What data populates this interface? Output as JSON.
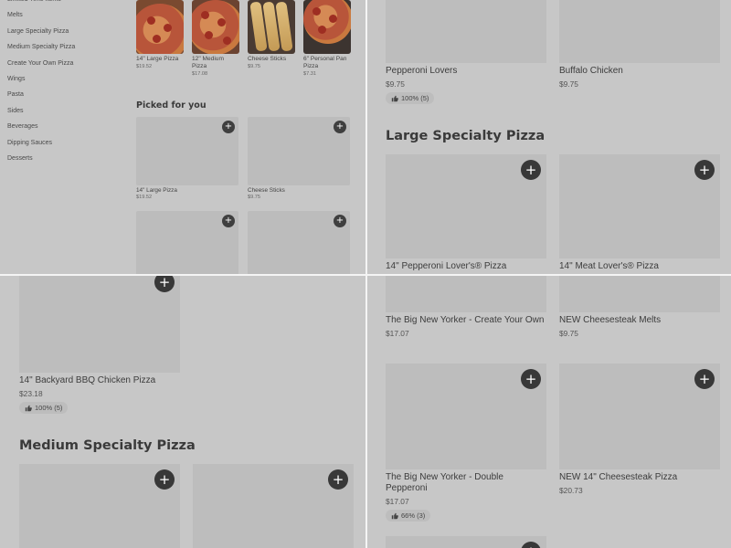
{
  "sidebar": {
    "items": [
      {
        "label": "Limited Time Items"
      },
      {
        "label": "Melts"
      },
      {
        "label": "Large Specialty Pizza"
      },
      {
        "label": "Medium Specialty Pizza"
      },
      {
        "label": "Create Your Own Pizza"
      },
      {
        "label": "Wings"
      },
      {
        "label": "Pasta"
      },
      {
        "label": "Sides"
      },
      {
        "label": "Beverages"
      },
      {
        "label": "Dipping Sauces"
      },
      {
        "label": "Desserts"
      }
    ]
  },
  "featured": [
    {
      "name": "14\" Large Pizza",
      "price": "$19.52"
    },
    {
      "name": "12\" Medium Pizza",
      "price": "$17.08"
    },
    {
      "name": "Cheese Sticks",
      "price": "$9.75"
    },
    {
      "name": "6\" Personal Pan Pizza",
      "price": "$7.31"
    }
  ],
  "picked_for_you": {
    "title": "Picked for you",
    "items": [
      {
        "name": "14\" Large Pizza",
        "price": "$19.52"
      },
      {
        "name": "Cheese Sticks",
        "price": "$9.75"
      }
    ]
  },
  "top_right": {
    "items": [
      {
        "name": "Pepperoni Lovers",
        "price": "$9.75",
        "rating": "100% (5)"
      },
      {
        "name": "Buffalo Chicken",
        "price": "$9.75"
      }
    ],
    "section_title": "Large Specialty Pizza",
    "section_items": [
      {
        "name": "14\" Pepperoni Lover's® Pizza"
      },
      {
        "name": "14\" Meat Lover's® Pizza"
      }
    ]
  },
  "bottom_left": {
    "item": {
      "name": "14\" Backyard BBQ Chicken Pizza",
      "price": "$23.18",
      "rating": "100% (5)"
    },
    "section_title": "Medium Specialty Pizza"
  },
  "bottom_right": {
    "items": [
      {
        "name": "The Big New Yorker - Create Your Own",
        "price": "$17.07"
      },
      {
        "name": "NEW Cheesesteak Melts",
        "price": "$9.75"
      },
      {
        "name": "The Big New Yorker - Double Pepperoni",
        "price": "$17.07",
        "rating": "66% (3)"
      },
      {
        "name": "NEW 14\" Cheesesteak Pizza",
        "price": "$20.73"
      }
    ]
  },
  "icons": {
    "add": "+",
    "thumbs_up": "thumbs-up-icon"
  },
  "colors": {
    "background": "#c7c7c7",
    "add_button": "#383838",
    "separator": "#f4f4f4"
  }
}
